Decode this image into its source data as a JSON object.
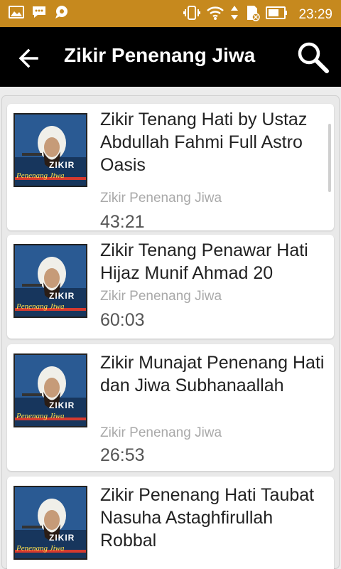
{
  "status_bar": {
    "time": "23:29",
    "icons_left": [
      "gallery-icon",
      "bbm-icon",
      "chat-icon"
    ],
    "icons_right": [
      "vibrate-icon",
      "wifi-icon",
      "data-arrows-icon",
      "sd-card-icon",
      "battery-icon"
    ]
  },
  "app_bar": {
    "title": "Zikir Penenang Jiwa",
    "back_icon": "arrow-left-icon",
    "search_icon": "search-icon"
  },
  "thumbnail": {
    "main_text": "ZIKIR",
    "sub_text": "Penenang Jiwa"
  },
  "tracks": [
    {
      "title": "Zikir Tenang Hati by Ustaz Abdullah Fahmi Full Astro Oasis",
      "album": "Zikir Penenang Jiwa",
      "duration": "43:21"
    },
    {
      "title": "Zikir Tenang Penawar Hati Hijaz Munif Ahmad 20",
      "album": "Zikir Penenang Jiwa",
      "duration": "60:03"
    },
    {
      "title": "Zikir Munajat Penenang Hati dan Jiwa Subhanaallah",
      "album": "Zikir Penenang Jiwa",
      "duration": "26:53"
    },
    {
      "title": "Zikir Penenang Hati Taubat Nasuha Astaghfirullah Robbal",
      "album": "",
      "duration": ""
    }
  ],
  "colors": {
    "status_bar": "#c6891e",
    "app_bar": "#000000",
    "background": "#ececec"
  }
}
